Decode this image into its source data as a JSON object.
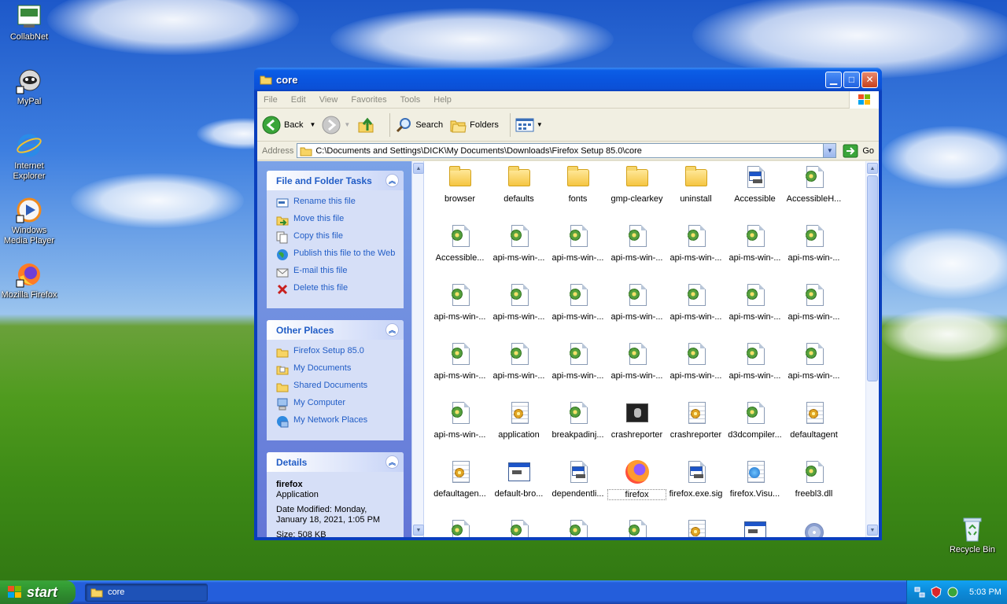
{
  "desktop": {
    "icons": [
      {
        "label": "CollabNet"
      },
      {
        "label": "MyPal"
      },
      {
        "label": "Internet Explorer"
      },
      {
        "label": "Windows Media Player"
      },
      {
        "label": "Mozilla Firefox"
      },
      {
        "label": "Recycle Bin"
      }
    ]
  },
  "window": {
    "title": "core",
    "menu": [
      "File",
      "Edit",
      "View",
      "Favorites",
      "Tools",
      "Help"
    ],
    "toolbar": {
      "back": "Back",
      "search": "Search",
      "folders": "Folders"
    },
    "address": {
      "label": "Address",
      "path": "C:\\Documents and Settings\\DICK\\My Documents\\Downloads\\Firefox Setup 85.0\\core",
      "go": "Go"
    },
    "taskpane": {
      "file_tasks": {
        "title": "File and Folder Tasks",
        "items": [
          "Rename this file",
          "Move this file",
          "Copy this file",
          "Publish this file to the Web",
          "E-mail this file",
          "Delete this file"
        ]
      },
      "other_places": {
        "title": "Other Places",
        "items": [
          "Firefox Setup 85.0",
          "My Documents",
          "Shared Documents",
          "My Computer",
          "My Network Places"
        ]
      },
      "details": {
        "title": "Details",
        "name": "firefox",
        "type": "Application",
        "modified": "Date Modified: Monday, January 18, 2021, 1:05 PM",
        "size": "Size: 508 KB"
      }
    },
    "files": [
      {
        "name": "browser",
        "icon": "folder"
      },
      {
        "name": "defaults",
        "icon": "folder"
      },
      {
        "name": "fonts",
        "icon": "folder"
      },
      {
        "name": "gmp-clearkey",
        "icon": "folder"
      },
      {
        "name": "uninstall",
        "icon": "folder"
      },
      {
        "name": "Accessible",
        "icon": "app-doc"
      },
      {
        "name": "AccessibleH...",
        "icon": "dll"
      },
      {
        "name": "Accessible...",
        "icon": "dll"
      },
      {
        "name": "api-ms-win-...",
        "icon": "dll"
      },
      {
        "name": "api-ms-win-...",
        "icon": "dll"
      },
      {
        "name": "api-ms-win-...",
        "icon": "dll"
      },
      {
        "name": "api-ms-win-...",
        "icon": "dll"
      },
      {
        "name": "api-ms-win-...",
        "icon": "dll"
      },
      {
        "name": "api-ms-win-...",
        "icon": "dll"
      },
      {
        "name": "api-ms-win-...",
        "icon": "dll"
      },
      {
        "name": "api-ms-win-...",
        "icon": "dll"
      },
      {
        "name": "api-ms-win-...",
        "icon": "dll"
      },
      {
        "name": "api-ms-win-...",
        "icon": "dll"
      },
      {
        "name": "api-ms-win-...",
        "icon": "dll"
      },
      {
        "name": "api-ms-win-...",
        "icon": "dll"
      },
      {
        "name": "api-ms-win-...",
        "icon": "dll"
      },
      {
        "name": "api-ms-win-...",
        "icon": "dll"
      },
      {
        "name": "api-ms-win-...",
        "icon": "dll"
      },
      {
        "name": "api-ms-win-...",
        "icon": "dll"
      },
      {
        "name": "api-ms-win-...",
        "icon": "dll"
      },
      {
        "name": "api-ms-win-...",
        "icon": "dll"
      },
      {
        "name": "api-ms-win-...",
        "icon": "dll"
      },
      {
        "name": "api-ms-win-...",
        "icon": "dll"
      },
      {
        "name": "api-ms-win-...",
        "icon": "dll"
      },
      {
        "name": "application",
        "icon": "config"
      },
      {
        "name": "breakpadinj...",
        "icon": "dll"
      },
      {
        "name": "crashreporter",
        "icon": "crash"
      },
      {
        "name": "crashreporter",
        "icon": "config"
      },
      {
        "name": "d3dcompiler...",
        "icon": "dll"
      },
      {
        "name": "defaultagent",
        "icon": "config"
      },
      {
        "name": "defaultagen...",
        "icon": "config"
      },
      {
        "name": "default-bro...",
        "icon": "app"
      },
      {
        "name": "dependentli...",
        "icon": "app-doc"
      },
      {
        "name": "firefox",
        "icon": "firefox"
      },
      {
        "name": "firefox.exe.sig",
        "icon": "app-doc"
      },
      {
        "name": "firefox.Visu...",
        "icon": "web-doc"
      },
      {
        "name": "freebl3.dll",
        "icon": "dll"
      },
      {
        "name": "",
        "icon": "dll"
      },
      {
        "name": "",
        "icon": "dll"
      },
      {
        "name": "",
        "icon": "dll"
      },
      {
        "name": "",
        "icon": "dll"
      },
      {
        "name": "",
        "icon": "config"
      },
      {
        "name": "",
        "icon": "app"
      },
      {
        "name": "",
        "icon": "disc"
      }
    ],
    "selected_file": "firefox"
  },
  "taskbar": {
    "start": "start",
    "items": [
      {
        "label": "core"
      }
    ],
    "time": "5:03 PM"
  },
  "colors": {
    "link": "#215dc6",
    "titlebar": "#0a55df",
    "taskbar": "#245edb",
    "start": "#2e8b2e"
  }
}
